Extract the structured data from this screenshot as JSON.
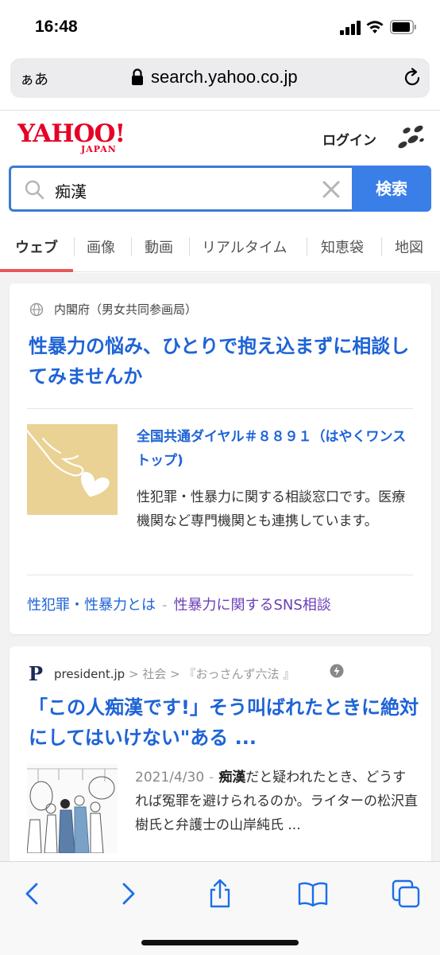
{
  "status_bar": {
    "time": "16:48"
  },
  "browser": {
    "text_size_label": "ぁあ",
    "host": "search.yahoo.co.jp"
  },
  "header": {
    "logo_text": "YAHOO!",
    "logo_sub": "JAPAN",
    "login_label": "ログイン"
  },
  "search": {
    "query": "痴漢",
    "button_label": "検索"
  },
  "tabs": [
    {
      "label": "ウェブ",
      "active": true
    },
    {
      "label": "画像"
    },
    {
      "label": "動画"
    },
    {
      "label": "リアルタイム"
    },
    {
      "label": "知恵袋"
    },
    {
      "label": "地図"
    }
  ],
  "result1": {
    "source": "内閣府（男女共同参画局）",
    "title": "性暴力の悩み、ひとりで抱え込まずに相談してみませんか",
    "sub_title": "全国共通ダイヤル＃８８９１（はやくワンストップ)",
    "description": "性犯罪・性暴力に関する相談窓口です。医療機関など専門機関とも連携しています。",
    "link1": "性犯罪・性暴力とは",
    "link_separator": "-",
    "link2": "性暴力に関するSNS相談"
  },
  "result2": {
    "site_logo": "P",
    "site": "president.jp",
    "crumb1": "社会",
    "crumb2": "『おっさんず六法 』",
    "crumb_sep": ">",
    "title": "「この人痴漢です!」そう叫ばれたときに絶対にしてはいけない\"ある ...",
    "date": "2021/4/30",
    "dash": "-",
    "keyword": "痴漢",
    "description": "だと疑われたとき、どうすれば冤罪を避けられるのか。ライターの松沢直樹氏と弁護士の山岸純氏 ..."
  },
  "colors": {
    "accent_blue": "#1e63d6",
    "search_button": "#3a7ee8",
    "tab_underline": "#e8595a",
    "yahoo_red": "#e60026",
    "visited_link": "#6a3fb5"
  },
  "icons": [
    "lock-icon",
    "reload-icon",
    "menu-icon",
    "search-icon",
    "clear-icon",
    "globe-icon",
    "bolt-icon",
    "back-icon",
    "forward-icon",
    "share-icon",
    "bookmarks-icon",
    "tabs-icon"
  ]
}
